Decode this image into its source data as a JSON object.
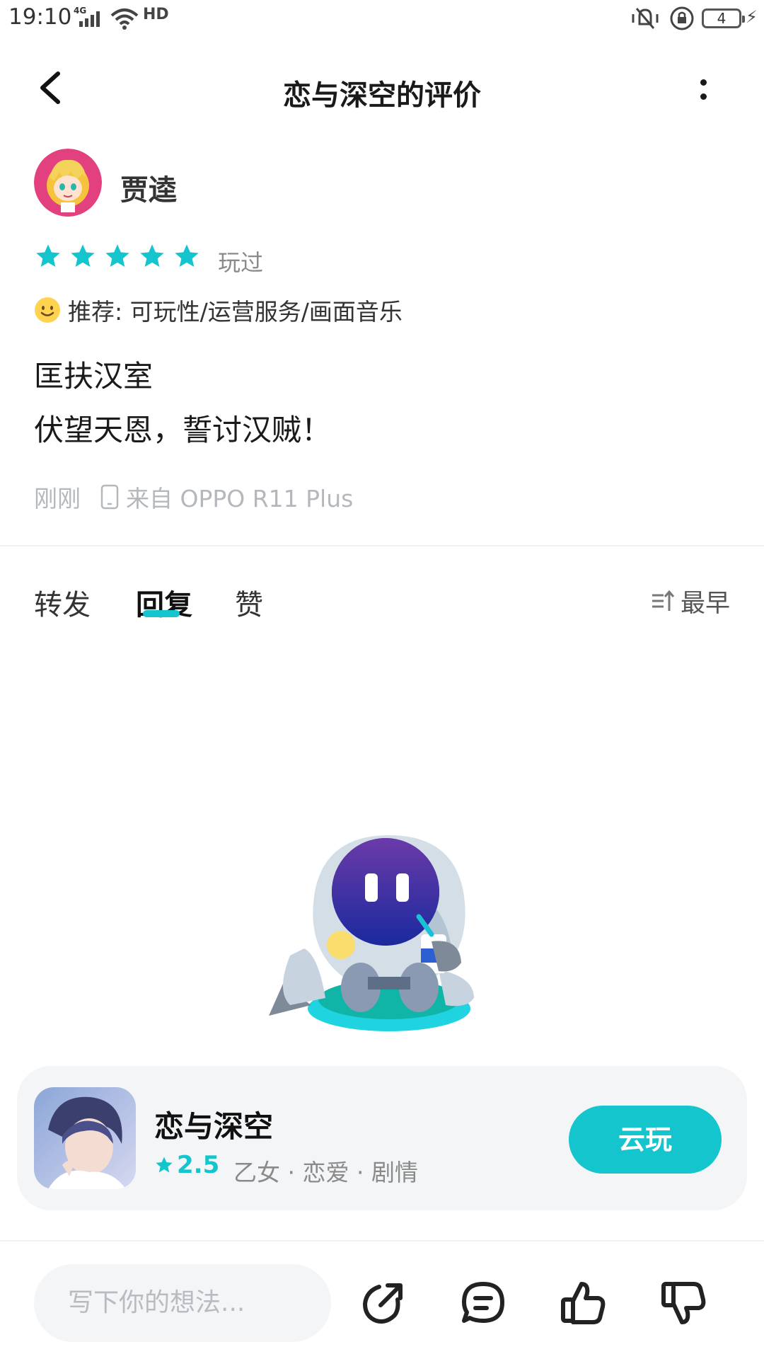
{
  "status_bar": {
    "time": "19:10",
    "network": "4G",
    "hd": "HD",
    "battery": "4"
  },
  "nav": {
    "title": "恋与深空的评价",
    "back_icon": "back-arrow-icon",
    "more_icon": "more-vertical-icon"
  },
  "review": {
    "username": "贾逵",
    "rating_stars": 5,
    "played_label": "玩过",
    "recommend": "推荐: 可玩性/运营服务/画面音乐",
    "content_line1": "匡扶汉室",
    "content_line2": "伏望天恩，誓讨汉贼！",
    "time": "刚刚",
    "device": "来自 OPPO R11 Plus"
  },
  "tabs": {
    "forward": "转发",
    "reply": "回复",
    "like": "赞",
    "active": "reply",
    "sort_label": "最早"
  },
  "game": {
    "name": "恋与深空",
    "rating": "2.5",
    "tags": "乙女 · 恋爱 · 剧情",
    "cloud_play": "云玩"
  },
  "bottom_bar": {
    "input_placeholder": "写下你的想法..."
  },
  "colors": {
    "accent": "#15c5ce",
    "star": "#15c5ce",
    "muted": "#b4b8bd"
  }
}
